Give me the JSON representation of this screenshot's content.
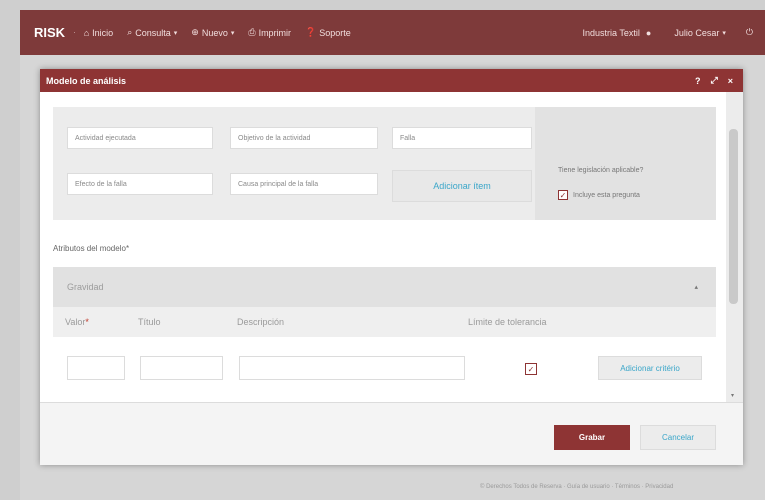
{
  "topbar": {
    "brand": "RISK",
    "separator": "·",
    "nav": [
      {
        "icon": "home-icon",
        "glyph": "⌂",
        "label": "Inicio",
        "has_caret": false
      },
      {
        "icon": "search-icon",
        "glyph": "⌕",
        "label": "Consulta",
        "has_caret": true
      },
      {
        "icon": "plus-circle-icon",
        "glyph": "⊕",
        "label": "Nuevo",
        "has_caret": true
      },
      {
        "icon": "print-icon",
        "glyph": "⎙",
        "label": "Imprimir",
        "has_caret": false
      },
      {
        "icon": "help-icon",
        "glyph": "❓",
        "label": "Soporte",
        "has_caret": false
      }
    ],
    "company": "Industria Textil",
    "user": "Julio Cesar",
    "caret": "▾"
  },
  "modal": {
    "title": "Modelo de análisis",
    "help": "?",
    "expand": "⤢",
    "close": "×",
    "fields": {
      "actividad": "Actividad ejecutada",
      "objetivo": "Objetivo de la actividad",
      "falla": "Falla",
      "efecto": "Efecto de la falla",
      "causa": "Causa principal de la falla"
    },
    "add_item": "Adicionar ítem",
    "question": "Tiene legislación aplicable?",
    "include_question": "Incluye esta pregunta",
    "attributes_label": "Atributos del modelo",
    "required_mark": "*",
    "gravity": "Gravidad",
    "criteria_columns": {
      "valor": "Valor",
      "titulo": "Título",
      "descripcion": "Descripción",
      "limite": "Límite de tolerancia"
    },
    "add_criterion": "Adicionar critério",
    "checkmark": "✓",
    "save": "Grabar",
    "cancel": "Cancelar"
  },
  "footer": "© Derechos Todos de Reserva · Guía de usuario · Términos · Privacidad"
}
